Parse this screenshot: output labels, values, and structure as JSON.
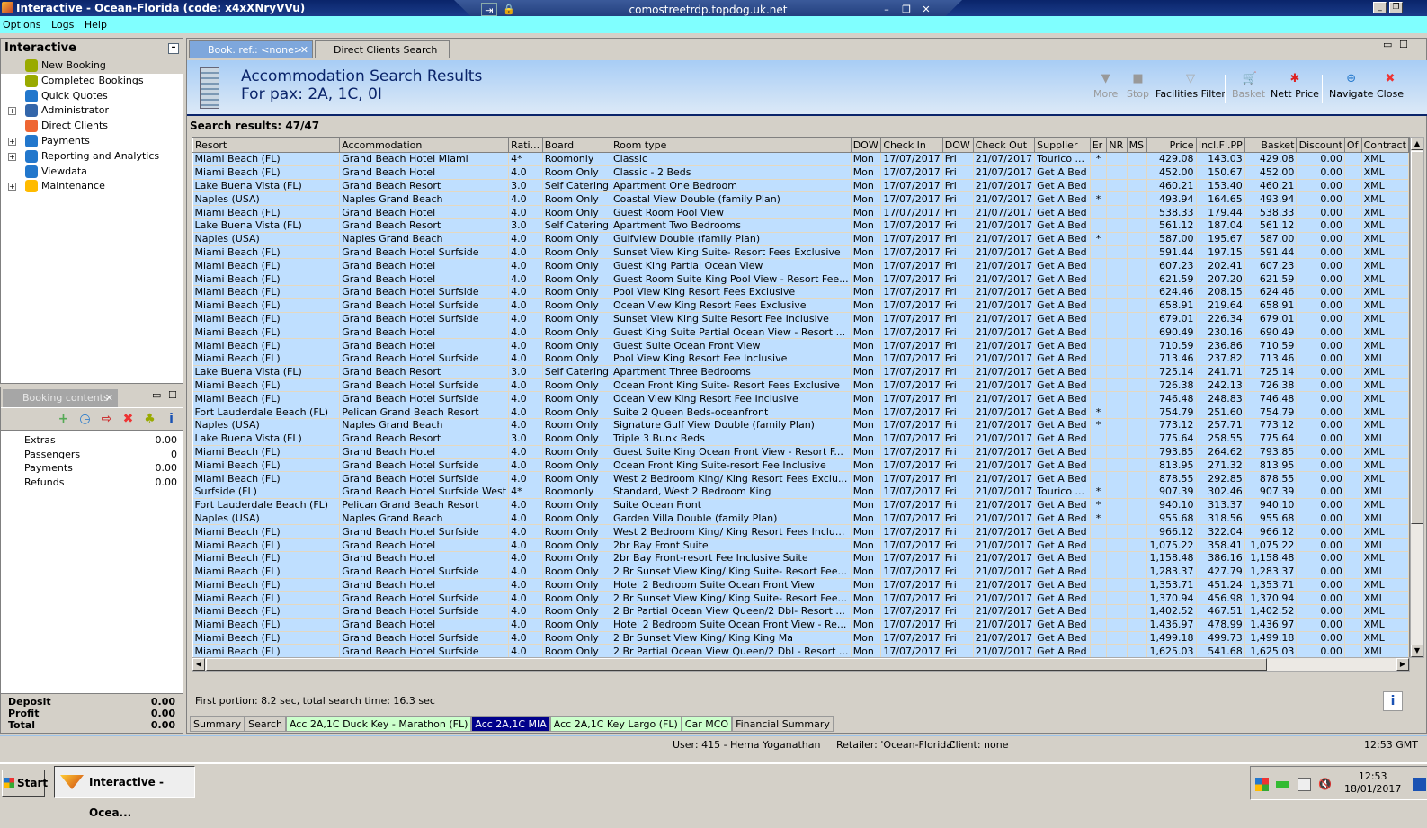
{
  "window": {
    "title": "Interactive - Ocean-Florida (code: x4xXNryVVu)",
    "rdp_host": "comostreetrdp.topdog.uk.net"
  },
  "menu": [
    "Options",
    "Logs",
    "Help"
  ],
  "left": {
    "title": "Interactive",
    "items": [
      {
        "label": "New Booking",
        "expand": false
      },
      {
        "label": "Completed Bookings",
        "expand": false
      },
      {
        "label": "Quick Quotes",
        "expand": false
      },
      {
        "label": "Administrator",
        "expand": true
      },
      {
        "label": "Direct Clients",
        "expand": false
      },
      {
        "label": "Payments",
        "expand": true
      },
      {
        "label": "Reporting and Analytics",
        "expand": true
      },
      {
        "label": "Viewdata",
        "expand": false
      },
      {
        "label": "Maintenance",
        "expand": true
      }
    ]
  },
  "booking": {
    "title": "Booking contents",
    "rows": [
      {
        "label": "Extras",
        "value": "0.00"
      },
      {
        "label": "Passengers",
        "value": "0"
      },
      {
        "label": "Payments",
        "value": "0.00"
      },
      {
        "label": "Refunds",
        "value": "0.00"
      }
    ],
    "totals": [
      {
        "label": "Deposit",
        "value": "0.00"
      },
      {
        "label": "Profit",
        "value": "0.00"
      },
      {
        "label": "Total",
        "value": "0.00"
      }
    ]
  },
  "tabs": [
    {
      "label": "Book. ref.: <none>"
    },
    {
      "label": "Direct Clients Search"
    }
  ],
  "header": {
    "title": "Accommodation Search Results",
    "subtitle": "For pax: 2A, 1C, 0I"
  },
  "toolbar": {
    "more": "More",
    "stop": "Stop",
    "facilities": "Facilities Filter",
    "basket": "Basket",
    "nett": "Nett Price",
    "navigate": "Navigate",
    "close": "Close"
  },
  "results_label": "Search results: 47/47",
  "columns": [
    "Resort",
    "Accommodation",
    "Rati...",
    "Board",
    "Room type",
    "DOW",
    "Check In",
    "DOW",
    "Check Out",
    "Supplier",
    "Er",
    "NR",
    "MS",
    "Price",
    "Incl.Fl.PP",
    "Basket",
    "Discount",
    "Of",
    "Contract"
  ],
  "rows": [
    [
      "Miami Beach (FL)",
      "Grand Beach Hotel Miami",
      "4*",
      "Roomonly",
      "Classic",
      "Mon",
      "17/07/2017",
      "Fri",
      "21/07/2017",
      "Tourico ...",
      "*",
      "",
      "",
      "429.08",
      "143.03",
      "429.08",
      "0.00",
      "",
      "XML"
    ],
    [
      "Miami Beach (FL)",
      "Grand Beach Hotel",
      "4.0",
      "Room Only",
      "Classic - 2 Beds",
      "Mon",
      "17/07/2017",
      "Fri",
      "21/07/2017",
      "Get A Bed",
      "",
      "",
      "",
      "452.00",
      "150.67",
      "452.00",
      "0.00",
      "",
      "XML"
    ],
    [
      "Lake Buena Vista (FL)",
      "Grand Beach Resort",
      "3.0",
      "Self Catering",
      "Apartment One Bedroom",
      "Mon",
      "17/07/2017",
      "Fri",
      "21/07/2017",
      "Get A Bed",
      "",
      "",
      "",
      "460.21",
      "153.40",
      "460.21",
      "0.00",
      "",
      "XML"
    ],
    [
      "Naples (USA)",
      "Naples Grand Beach",
      "4.0",
      "Room Only",
      "Coastal View Double (family Plan)",
      "Mon",
      "17/07/2017",
      "Fri",
      "21/07/2017",
      "Get A Bed",
      "*",
      "",
      "",
      "493.94",
      "164.65",
      "493.94",
      "0.00",
      "",
      "XML"
    ],
    [
      "Miami Beach (FL)",
      "Grand Beach Hotel",
      "4.0",
      "Room Only",
      "Guest Room Pool View",
      "Mon",
      "17/07/2017",
      "Fri",
      "21/07/2017",
      "Get A Bed",
      "",
      "",
      "",
      "538.33",
      "179.44",
      "538.33",
      "0.00",
      "",
      "XML"
    ],
    [
      "Lake Buena Vista (FL)",
      "Grand Beach Resort",
      "3.0",
      "Self Catering",
      "Apartment Two Bedrooms",
      "Mon",
      "17/07/2017",
      "Fri",
      "21/07/2017",
      "Get A Bed",
      "",
      "",
      "",
      "561.12",
      "187.04",
      "561.12",
      "0.00",
      "",
      "XML"
    ],
    [
      "Naples (USA)",
      "Naples Grand Beach",
      "4.0",
      "Room Only",
      "Gulfview Double (family Plan)",
      "Mon",
      "17/07/2017",
      "Fri",
      "21/07/2017",
      "Get A Bed",
      "*",
      "",
      "",
      "587.00",
      "195.67",
      "587.00",
      "0.00",
      "",
      "XML"
    ],
    [
      "Miami Beach (FL)",
      "Grand Beach Hotel Surfside",
      "4.0",
      "Room Only",
      "Sunset View  King Suite- Resort Fees Exclusive",
      "Mon",
      "17/07/2017",
      "Fri",
      "21/07/2017",
      "Get A Bed",
      "",
      "",
      "",
      "591.44",
      "197.15",
      "591.44",
      "0.00",
      "",
      "XML"
    ],
    [
      "Miami Beach (FL)",
      "Grand Beach Hotel",
      "4.0",
      "Room Only",
      "Guest King Partial Ocean View",
      "Mon",
      "17/07/2017",
      "Fri",
      "21/07/2017",
      "Get A Bed",
      "",
      "",
      "",
      "607.23",
      "202.41",
      "607.23",
      "0.00",
      "",
      "XML"
    ],
    [
      "Miami Beach (FL)",
      "Grand Beach Hotel",
      "4.0",
      "Room Only",
      "Guest Room Suite King Pool View - Resort Fee...",
      "Mon",
      "17/07/2017",
      "Fri",
      "21/07/2017",
      "Get A Bed",
      "",
      "",
      "",
      "621.59",
      "207.20",
      "621.59",
      "0.00",
      "",
      "XML"
    ],
    [
      "Miami Beach (FL)",
      "Grand Beach Hotel Surfside",
      "4.0",
      "Room Only",
      "Pool View King Resort Fees Exclusive",
      "Mon",
      "17/07/2017",
      "Fri",
      "21/07/2017",
      "Get A Bed",
      "",
      "",
      "",
      "624.46",
      "208.15",
      "624.46",
      "0.00",
      "",
      "XML"
    ],
    [
      "Miami Beach (FL)",
      "Grand Beach Hotel Surfside",
      "4.0",
      "Room Only",
      "Ocean View King Resort Fees Exclusive",
      "Mon",
      "17/07/2017",
      "Fri",
      "21/07/2017",
      "Get A Bed",
      "",
      "",
      "",
      "658.91",
      "219.64",
      "658.91",
      "0.00",
      "",
      "XML"
    ],
    [
      "Miami Beach (FL)",
      "Grand Beach Hotel Surfside",
      "4.0",
      "Room Only",
      "Sunset View King Suite Resort Fee Inclusive",
      "Mon",
      "17/07/2017",
      "Fri",
      "21/07/2017",
      "Get A Bed",
      "",
      "",
      "",
      "679.01",
      "226.34",
      "679.01",
      "0.00",
      "",
      "XML"
    ],
    [
      "Miami Beach (FL)",
      "Grand Beach Hotel",
      "4.0",
      "Room Only",
      "Guest King Suite Partial Ocean View - Resort ...",
      "Mon",
      "17/07/2017",
      "Fri",
      "21/07/2017",
      "Get A Bed",
      "",
      "",
      "",
      "690.49",
      "230.16",
      "690.49",
      "0.00",
      "",
      "XML"
    ],
    [
      "Miami Beach (FL)",
      "Grand Beach Hotel",
      "4.0",
      "Room Only",
      "Guest Suite Ocean Front View",
      "Mon",
      "17/07/2017",
      "Fri",
      "21/07/2017",
      "Get A Bed",
      "",
      "",
      "",
      "710.59",
      "236.86",
      "710.59",
      "0.00",
      "",
      "XML"
    ],
    [
      "Miami Beach (FL)",
      "Grand Beach Hotel Surfside",
      "4.0",
      "Room Only",
      "Pool View King Resort Fee Inclusive",
      "Mon",
      "17/07/2017",
      "Fri",
      "21/07/2017",
      "Get A Bed",
      "",
      "",
      "",
      "713.46",
      "237.82",
      "713.46",
      "0.00",
      "",
      "XML"
    ],
    [
      "Lake Buena Vista (FL)",
      "Grand Beach Resort",
      "3.0",
      "Self Catering",
      "Apartment Three Bedrooms",
      "Mon",
      "17/07/2017",
      "Fri",
      "21/07/2017",
      "Get A Bed",
      "",
      "",
      "",
      "725.14",
      "241.71",
      "725.14",
      "0.00",
      "",
      "XML"
    ],
    [
      "Miami Beach (FL)",
      "Grand Beach Hotel Surfside",
      "4.0",
      "Room Only",
      "Ocean Front  King Suite- Resort Fees Exclusive",
      "Mon",
      "17/07/2017",
      "Fri",
      "21/07/2017",
      "Get A Bed",
      "",
      "",
      "",
      "726.38",
      "242.13",
      "726.38",
      "0.00",
      "",
      "XML"
    ],
    [
      "Miami Beach (FL)",
      "Grand Beach Hotel Surfside",
      "4.0",
      "Room Only",
      "Ocean View King Resort Fee Inclusive",
      "Mon",
      "17/07/2017",
      "Fri",
      "21/07/2017",
      "Get A Bed",
      "",
      "",
      "",
      "746.48",
      "248.83",
      "746.48",
      "0.00",
      "",
      "XML"
    ],
    [
      "Fort Lauderdale Beach (FL)",
      "Pelican Grand Beach Resort",
      "4.0",
      "Room Only",
      "Suite 2 Queen Beds-oceanfront",
      "Mon",
      "17/07/2017",
      "Fri",
      "21/07/2017",
      "Get A Bed",
      "*",
      "",
      "",
      "754.79",
      "251.60",
      "754.79",
      "0.00",
      "",
      "XML"
    ],
    [
      "Naples (USA)",
      "Naples Grand Beach",
      "4.0",
      "Room Only",
      "Signature Gulf View Double (family Plan)",
      "Mon",
      "17/07/2017",
      "Fri",
      "21/07/2017",
      "Get A Bed",
      "*",
      "",
      "",
      "773.12",
      "257.71",
      "773.12",
      "0.00",
      "",
      "XML"
    ],
    [
      "Lake Buena Vista (FL)",
      "Grand Beach Resort",
      "3.0",
      "Room Only",
      "Triple 3 Bunk Beds",
      "Mon",
      "17/07/2017",
      "Fri",
      "21/07/2017",
      "Get A Bed",
      "",
      "",
      "",
      "775.64",
      "258.55",
      "775.64",
      "0.00",
      "",
      "XML"
    ],
    [
      "Miami Beach (FL)",
      "Grand Beach Hotel",
      "4.0",
      "Room Only",
      "Guest Suite King Ocean Front View - Resort F...",
      "Mon",
      "17/07/2017",
      "Fri",
      "21/07/2017",
      "Get A Bed",
      "",
      "",
      "",
      "793.85",
      "264.62",
      "793.85",
      "0.00",
      "",
      "XML"
    ],
    [
      "Miami Beach (FL)",
      "Grand Beach Hotel Surfside",
      "4.0",
      "Room Only",
      "Ocean Front King Suite-resort Fee Inclusive",
      "Mon",
      "17/07/2017",
      "Fri",
      "21/07/2017",
      "Get A Bed",
      "",
      "",
      "",
      "813.95",
      "271.32",
      "813.95",
      "0.00",
      "",
      "XML"
    ],
    [
      "Miami Beach (FL)",
      "Grand Beach Hotel Surfside",
      "4.0",
      "Room Only",
      "West 2 Bedroom King/ King Resort Fees Exclu...",
      "Mon",
      "17/07/2017",
      "Fri",
      "21/07/2017",
      "Get A Bed",
      "",
      "",
      "",
      "878.55",
      "292.85",
      "878.55",
      "0.00",
      "",
      "XML"
    ],
    [
      "Surfside (FL)",
      "Grand Beach Hotel Surfside West",
      "4*",
      "Roomonly",
      "Standard, West 2 Bedroom King",
      "Mon",
      "17/07/2017",
      "Fri",
      "21/07/2017",
      "Tourico ...",
      "*",
      "",
      "",
      "907.39",
      "302.46",
      "907.39",
      "0.00",
      "",
      "XML"
    ],
    [
      "Fort Lauderdale Beach (FL)",
      "Pelican Grand Beach Resort",
      "4.0",
      "Room Only",
      "Suite Ocean Front",
      "Mon",
      "17/07/2017",
      "Fri",
      "21/07/2017",
      "Get A Bed",
      "*",
      "",
      "",
      "940.10",
      "313.37",
      "940.10",
      "0.00",
      "",
      "XML"
    ],
    [
      "Naples (USA)",
      "Naples Grand Beach",
      "4.0",
      "Room Only",
      "Garden Villa Double (family Plan)",
      "Mon",
      "17/07/2017",
      "Fri",
      "21/07/2017",
      "Get A Bed",
      "*",
      "",
      "",
      "955.68",
      "318.56",
      "955.68",
      "0.00",
      "",
      "XML"
    ],
    [
      "Miami Beach (FL)",
      "Grand Beach Hotel Surfside",
      "4.0",
      "Room Only",
      "West 2 Bedroom King/ King Resort Fees Inclu...",
      "Mon",
      "17/07/2017",
      "Fri",
      "21/07/2017",
      "Get A Bed",
      "",
      "",
      "",
      "966.12",
      "322.04",
      "966.12",
      "0.00",
      "",
      "XML"
    ],
    [
      "Miami Beach (FL)",
      "Grand Beach Hotel",
      "4.0",
      "Room Only",
      "2br Bay Front Suite",
      "Mon",
      "17/07/2017",
      "Fri",
      "21/07/2017",
      "Get A Bed",
      "",
      "",
      "",
      "1,075.22",
      "358.41",
      "1,075.22",
      "0.00",
      "",
      "XML"
    ],
    [
      "Miami Beach (FL)",
      "Grand Beach Hotel",
      "4.0",
      "Room Only",
      "2br Bay Front-resort Fee Inclusive Suite",
      "Mon",
      "17/07/2017",
      "Fri",
      "21/07/2017",
      "Get A Bed",
      "",
      "",
      "",
      "1,158.48",
      "386.16",
      "1,158.48",
      "0.00",
      "",
      "XML"
    ],
    [
      "Miami Beach (FL)",
      "Grand Beach Hotel Surfside",
      "4.0",
      "Room Only",
      "2 Br Sunset View King/ King Suite- Resort Fee...",
      "Mon",
      "17/07/2017",
      "Fri",
      "21/07/2017",
      "Get A Bed",
      "",
      "",
      "",
      "1,283.37",
      "427.79",
      "1,283.37",
      "0.00",
      "",
      "XML"
    ],
    [
      "Miami Beach (FL)",
      "Grand Beach Hotel",
      "4.0",
      "Room Only",
      "Hotel 2 Bedroom Suite Ocean Front View",
      "Mon",
      "17/07/2017",
      "Fri",
      "21/07/2017",
      "Get A Bed",
      "",
      "",
      "",
      "1,353.71",
      "451.24",
      "1,353.71",
      "0.00",
      "",
      "XML"
    ],
    [
      "Miami Beach (FL)",
      "Grand Beach Hotel Surfside",
      "4.0",
      "Room Only",
      "2 Br Sunset View King/ King Suite- Resort Fee...",
      "Mon",
      "17/07/2017",
      "Fri",
      "21/07/2017",
      "Get A Bed",
      "",
      "",
      "",
      "1,370.94",
      "456.98",
      "1,370.94",
      "0.00",
      "",
      "XML"
    ],
    [
      "Miami Beach (FL)",
      "Grand Beach Hotel Surfside",
      "4.0",
      "Room Only",
      "2 Br Partial Ocean View Queen/2 Dbl- Resort ...",
      "Mon",
      "17/07/2017",
      "Fri",
      "21/07/2017",
      "Get A Bed",
      "",
      "",
      "",
      "1,402.52",
      "467.51",
      "1,402.52",
      "0.00",
      "",
      "XML"
    ],
    [
      "Miami Beach (FL)",
      "Grand Beach Hotel",
      "4.0",
      "Room Only",
      "Hotel 2 Bedroom Suite Ocean Front View - Re...",
      "Mon",
      "17/07/2017",
      "Fri",
      "21/07/2017",
      "Get A Bed",
      "",
      "",
      "",
      "1,436.97",
      "478.99",
      "1,436.97",
      "0.00",
      "",
      "XML"
    ],
    [
      "Miami Beach (FL)",
      "Grand Beach Hotel Surfside",
      "4.0",
      "Room Only",
      "2 Br Sunset View King/ King King Ma",
      "Mon",
      "17/07/2017",
      "Fri",
      "21/07/2017",
      "Get A Bed",
      "",
      "",
      "",
      "1,499.18",
      "499.73",
      "1,499.18",
      "0.00",
      "",
      "XML"
    ],
    [
      "Miami Beach (FL)",
      "Grand Beach Hotel Surfside",
      "4.0",
      "Room Only",
      "2 Br Partial Ocean View Queen/2 Dbl - Resort ...",
      "Mon",
      "17/07/2017",
      "Fri",
      "21/07/2017",
      "Get A Bed",
      "",
      "",
      "",
      "1,625.03",
      "541.68",
      "1,625.03",
      "0.00",
      "",
      "XML"
    ]
  ],
  "status": "First portion: 8.2 sec, total search time: 16.3 sec",
  "bottom_tabs": [
    {
      "label": "Summary",
      "style": "n"
    },
    {
      "label": "Search",
      "style": "n"
    },
    {
      "label": "Acc 2A,1C Duck Key - Marathon (FL)",
      "style": "g"
    },
    {
      "label": "Acc 2A,1C MIA",
      "style": "a"
    },
    {
      "label": "Acc 2A,1C Key Largo (FL)",
      "style": "g"
    },
    {
      "label": "Car MCO",
      "style": "g"
    },
    {
      "label": "Financial Summary",
      "style": "n"
    }
  ],
  "userbar": {
    "user": "User: 415 - Hema Yoganathan",
    "retailer": "Retailer: 'Ocean-Florida'",
    "client": "Client: none",
    "time": "12:53 GMT"
  },
  "taskbar": {
    "start": "Start",
    "app": "Interactive - Ocea...",
    "clock_time": "12:53",
    "clock_date": "18/01/2017"
  }
}
